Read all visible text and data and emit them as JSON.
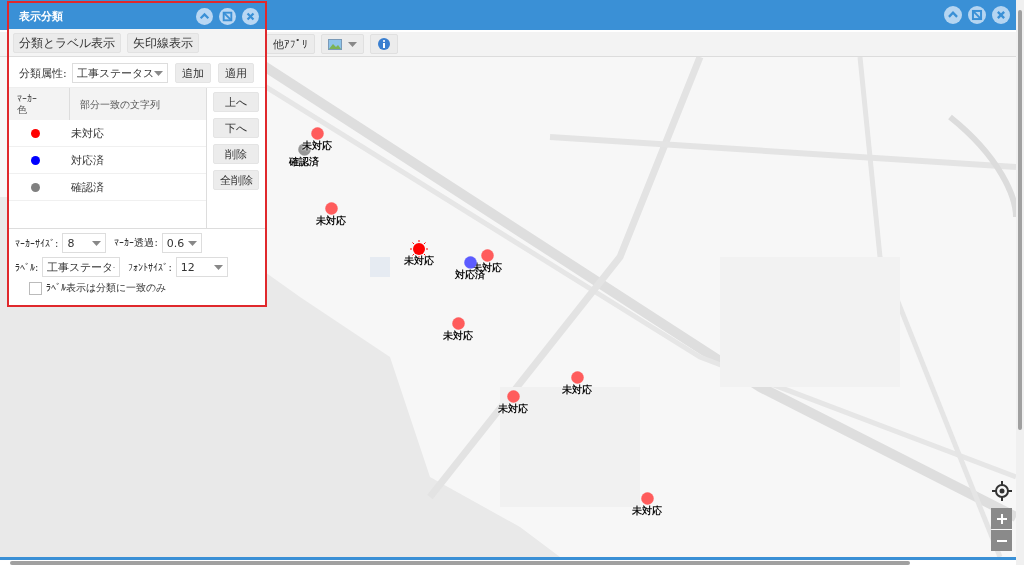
{
  "window": {
    "toolbar": {
      "apps_button": "他ｱﾌﾟﾘ"
    }
  },
  "panel": {
    "title": "表示分類",
    "tabs": [
      {
        "label": "分類とラベル表示"
      },
      {
        "label": "矢印線表示"
      }
    ],
    "attribute": {
      "label": "分類属性:",
      "value": "工事ステータス"
    },
    "actions": [
      "追加",
      "適用"
    ],
    "table": {
      "marker_header": [
        "ﾏｰｶｰ",
        "色"
      ],
      "string_header": "部分一致の文字列",
      "rows": [
        {
          "color": "#ff0000",
          "text": "未対応"
        },
        {
          "color": "#0000ff",
          "text": "対応済"
        },
        {
          "color": "#808080",
          "text": "確認済"
        }
      ]
    },
    "side_buttons": [
      "上へ",
      "下へ",
      "削除",
      "全削除"
    ],
    "settings": [
      {
        "label": "ﾏｰｶｰｻｲｽﾞ:",
        "value": "8"
      },
      {
        "label": "ﾏｰｶｰ透過:",
        "value": "0.6"
      },
      {
        "label": "ﾗﾍﾞﾙ:",
        "value": "工事ステータ"
      },
      {
        "label": "ﾌｫﾝﾄｻｲｽﾞ:",
        "value": "12"
      }
    ],
    "label_filter": {
      "label": "ﾗﾍﾞﾙ表示は分類に一致のみ",
      "checked": false
    }
  },
  "markers": [
    {
      "label": "確認済",
      "color": "#969696",
      "highlighted": false
    },
    {
      "label": "未対応",
      "color": "#ff5c5c",
      "highlighted": false
    },
    {
      "label": "未対応",
      "color": "#ff5c5c",
      "highlighted": false
    },
    {
      "label": "未対応",
      "color": "#ff0000",
      "highlighted": true
    },
    {
      "label": "未対応",
      "color": "#ff5c5c",
      "highlighted": false
    },
    {
      "label": "対応済",
      "color": "#5c5cff",
      "highlighted": false
    },
    {
      "label": "未対応",
      "color": "#ff5c5c",
      "highlighted": false
    },
    {
      "label": "未対応",
      "color": "#ff5c5c",
      "highlighted": false
    },
    {
      "label": "未対応",
      "color": "#ff5c5c",
      "highlighted": false
    },
    {
      "label": "未対応",
      "color": "#ff5c5c",
      "highlighted": false
    }
  ]
}
